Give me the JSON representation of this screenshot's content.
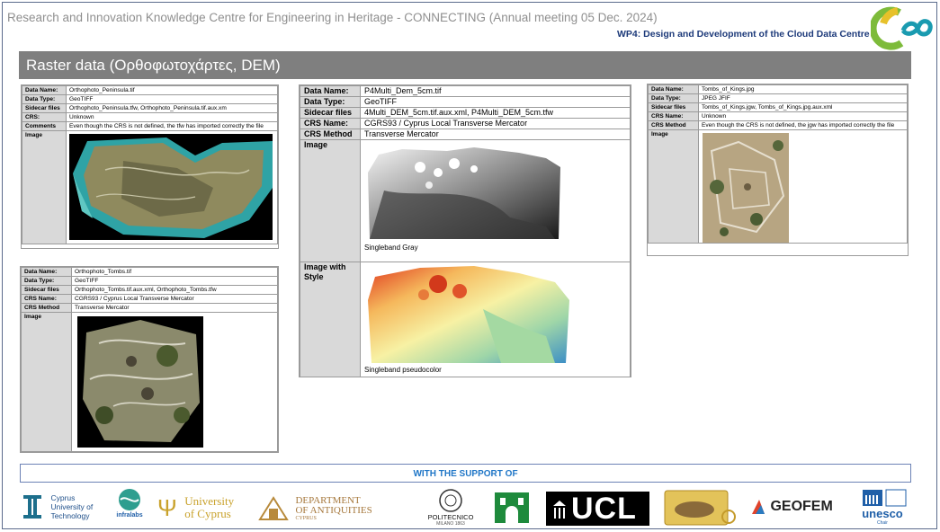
{
  "header": {
    "title": "Research and Innovation Knowledge Centre for Engineering in Heritage - CONNECTING (Annual meeting 05 Dec. 2024)",
    "wp": "WP4: Design and Development of the Cloud Data Centre"
  },
  "section": {
    "title": "Raster data (Ορθοφωτοχάρτες, DEM)"
  },
  "cards": {
    "peninsula": {
      "labels": {
        "name": "Data Name:",
        "type": "Data Type:",
        "sidecar": "Sidecar files",
        "crs": "CRS:",
        "comments": "Comments",
        "image": "Image"
      },
      "name": "Orthophoto_Peninsula.tif",
      "type": "GeoTIFF",
      "sidecar": "Orthophoto_Peninsula.tfw, Orthophoto_Peninsula.tif.aux.xm",
      "crs": "Unknown",
      "comments": "Even though the CRS is not defined, the tfw has imported correctly the file"
    },
    "tombs": {
      "labels": {
        "name": "Data Name:",
        "type": "Data Type:",
        "sidecar": "Sidecar files",
        "crs_name": "CRS Name:",
        "crs_method": "CRS Method",
        "image": "Image"
      },
      "name": "Orthophoto_Tombs.tif",
      "type": "GeoTIFF",
      "sidecar": "Orthophoto_Tombs.tif.aux.xml, Orthophoto_Tombs.tfw",
      "crs_name": "CGRS93 / Cyprus Local Transverse Mercator",
      "crs_method": "Transverse Mercator"
    },
    "dem": {
      "labels": {
        "name": "Data Name:",
        "type": "Data Type:",
        "sidecar": "Sidecar files",
        "crs_name": "CRS Name:",
        "crs_method": "CRS Method",
        "image": "Image",
        "image_style": "Image with Style"
      },
      "name": "P4Multi_Dem_5cm.tif",
      "type": "GeoTIFF",
      "sidecar": "4Multi_DEM_5cm.tif.aux.xml, P4Multi_DEM_5cm.tfw",
      "crs_name": "CGRS93 / Cyprus Local Transverse Mercator",
      "crs_method": "Transverse Mercator",
      "caption_gray": "Singleband Gray",
      "caption_pseudo": "Singleband pseudocolor"
    },
    "kings": {
      "labels": {
        "name": "Data Name:",
        "type": "Data Type:",
        "sidecar": "Sidecar files",
        "crs_name": "CRS Name:",
        "crs_method": "CRS Method",
        "image": "Image"
      },
      "name": "Tombs_of_Kings.jpg",
      "type": "JPEG JFIF",
      "sidecar": "Tombs_of_Kings.jgw, Tombs_of_Kings.jpg.aux.xml",
      "crs_name": "Unknown",
      "crs_method": "Even though the CRS is not defined, the jgw has imported correctly the file"
    }
  },
  "support": {
    "title": "WITH THE SUPPORT OF"
  },
  "logos": {
    "cut": [
      "Cyprus",
      "University of",
      "Technology"
    ],
    "infralabs": "infralabs",
    "ucy": [
      "University",
      "of Cyprus"
    ],
    "doa": [
      "DEPARTMENT",
      "OF ANTIQUITIES",
      "CYPRUS"
    ],
    "polimi": [
      "POLITECNICO",
      "MILANO 1863"
    ],
    "ucl": "UCL",
    "geofem": "GEOFEM",
    "unesco": [
      "unesco",
      "Chair"
    ]
  },
  "colors": {
    "band": "#7f7f7f",
    "support_text": "#1f76c7",
    "wp_text": "#1d3a7a",
    "ucl_bg": "#000000",
    "unesco_blue": "#1f5fa8"
  }
}
